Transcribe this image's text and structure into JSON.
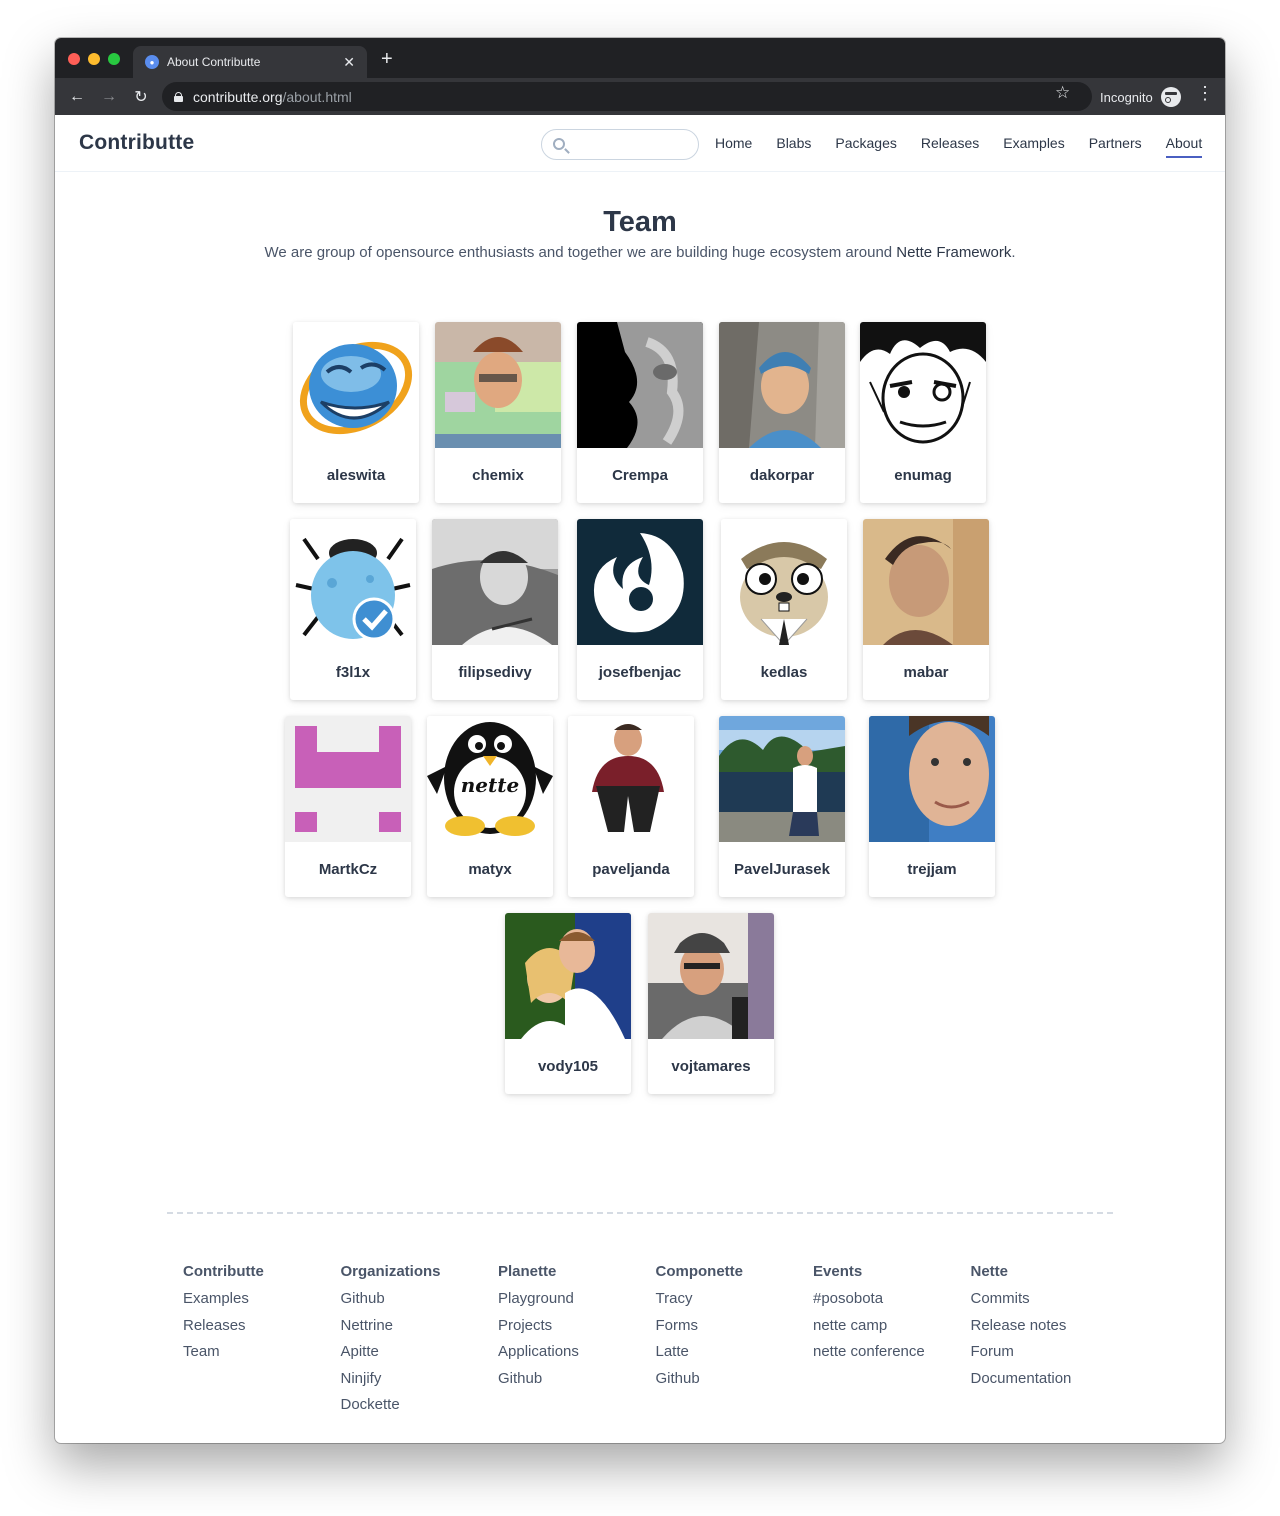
{
  "browser": {
    "tab_title": "About Contributte",
    "url_host": "contributte.org",
    "url_path": "/about.html",
    "incognito_label": "Incognito"
  },
  "site": {
    "logo": "Contributte",
    "search_placeholder": "",
    "nav": [
      "Home",
      "Blabs",
      "Packages",
      "Releases",
      "Examples",
      "Partners",
      "About"
    ],
    "active_nav": "About"
  },
  "team": {
    "title": "Team",
    "subtitle_prefix": "We are group of opensource enthusiasts and together we are building huge ecosystem around ",
    "subtitle_link": "Nette Framework",
    "subtitle_suffix": ".",
    "members": [
      {
        "name": "aleswita",
        "avatar": "troll-ie-icon"
      },
      {
        "name": "chemix",
        "avatar": "person-glitch-photo"
      },
      {
        "name": "Crempa",
        "avatar": "stone-face-photo"
      },
      {
        "name": "dakorpar",
        "avatar": "person-climber-photo"
      },
      {
        "name": "enumag",
        "avatar": "manga-face-drawing"
      },
      {
        "name": "f3l1x",
        "avatar": "blue-bug-icon"
      },
      {
        "name": "filipsedivy",
        "avatar": "person-bw-photo"
      },
      {
        "name": "josefbenjac",
        "avatar": "white-bird-logo"
      },
      {
        "name": "kedlas",
        "avatar": "gopher-cartoon"
      },
      {
        "name": "mabar",
        "avatar": "person-vintage-photo"
      },
      {
        "name": "MartkCz",
        "avatar": "pink-pixel-identicon"
      },
      {
        "name": "matyx",
        "avatar": "nette-penguin-logo"
      },
      {
        "name": "paveljanda",
        "avatar": "person-crouching-photo"
      },
      {
        "name": "PavelJurasek",
        "avatar": "person-lake-photo"
      },
      {
        "name": "trejjam",
        "avatar": "person-closeup-photo"
      },
      {
        "name": "vody105",
        "avatar": "couple-photo"
      },
      {
        "name": "vojtamares",
        "avatar": "person-hat-photo"
      }
    ]
  },
  "footer": {
    "columns": [
      {
        "title": "Contributte",
        "items": [
          "Examples",
          "Releases",
          "Team"
        ]
      },
      {
        "title": "Organizations",
        "items": [
          "Github",
          "Nettrine",
          "Apitte",
          "Ninjify",
          "Dockette"
        ]
      },
      {
        "title": "Planette",
        "items": [
          "Playground",
          "Projects",
          "Applications",
          "Github"
        ]
      },
      {
        "title": "Componette",
        "items": [
          "Tracy",
          "Forms",
          "Latte",
          "Github"
        ]
      },
      {
        "title": "Events",
        "items": [
          "#posobota",
          "nette camp",
          "nette conference"
        ]
      },
      {
        "title": "Nette",
        "items": [
          "Commits",
          "Release notes",
          "Forum",
          "Documentation"
        ]
      }
    ]
  },
  "colors": {
    "accent": "#4a5fc1",
    "text": "#2d3748",
    "chrome_dark": "#202124",
    "chrome_mid": "#35363a"
  }
}
